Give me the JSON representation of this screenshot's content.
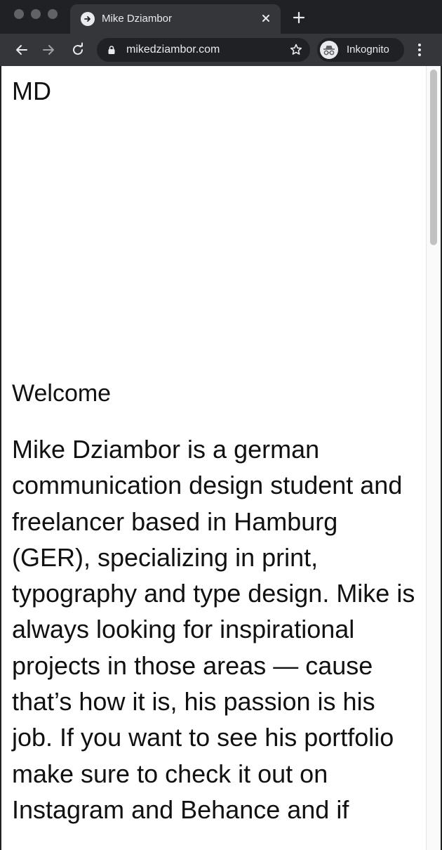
{
  "browser": {
    "tab": {
      "title": "Mike Dziambor"
    },
    "address_bar": {
      "url": "mikedziambor.com"
    },
    "profile": {
      "label": "Inkognito"
    }
  },
  "page": {
    "logo": "MD",
    "section_title": "Welcome",
    "intro_text": "Mike Dziambor is a german communication design student and freelancer based in Hamburg (GER), specializing in print, typography and type design. Mike is always looking for inspirational projects in those areas — cause that’s how it is, his passion is his job. If you want to see his portfolio make sure to check it out on Instagram and Behance and if"
  },
  "colors": {
    "frame_dark": "#202124",
    "toolbar": "#35363a",
    "text_light": "#e8eaed",
    "page_background": "#ffffff",
    "page_text": "#111111"
  },
  "icons": {
    "window_controls": [
      "close-dot",
      "minimize-dot",
      "zoom-dot"
    ],
    "tab_favicon": "arrow-right-circle-icon",
    "tab_close": "close-icon",
    "new_tab": "plus-icon",
    "back": "arrow-left-icon",
    "forward": "arrow-right-icon",
    "reload": "reload-icon",
    "secure": "lock-icon",
    "bookmark": "star-icon",
    "incognito": "incognito-icon",
    "menu": "kebab-menu-icon"
  }
}
